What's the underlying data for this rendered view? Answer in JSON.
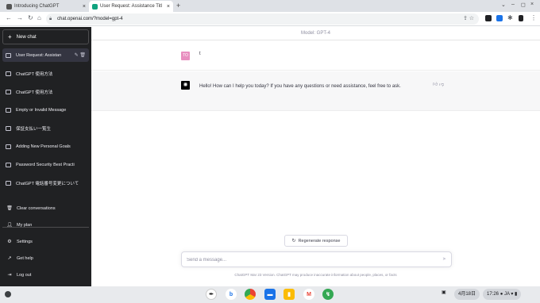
{
  "browser": {
    "tabs": [
      {
        "title": "Introducing ChatGPT",
        "active": false
      },
      {
        "title": "User Request: Assistance Titl",
        "active": true
      }
    ],
    "url": "chat.openai.com/?model=gpt-4"
  },
  "sidebar": {
    "new_chat": "New chat",
    "items": [
      {
        "label": "User Request: Assistan",
        "active": true
      },
      {
        "label": "ChatGPT 使用方法"
      },
      {
        "label": "ChatGPT 使用方法"
      },
      {
        "label": "Empty or Invalid Message"
      },
      {
        "label": "保証支払い一覧生"
      },
      {
        "label": "Adding New Personal Goals"
      },
      {
        "label": "Password Security Best Practi"
      },
      {
        "label": "ChatGPT 電話番号変更について"
      }
    ],
    "footer": [
      {
        "label": "Clear conversations",
        "icon": "trash-icon"
      },
      {
        "label": "My plan",
        "icon": "user-icon"
      },
      {
        "label": "Settings",
        "icon": "gear-icon"
      },
      {
        "label": "Get help",
        "icon": "external-link-icon"
      },
      {
        "label": "Log out",
        "icon": "logout-icon"
      }
    ]
  },
  "main": {
    "model_label": "Model: GPT-4",
    "user_avatar": "TO",
    "user_message": "t",
    "assistant_message": "Hello! How can I help you today? If you have any questions or need assistance, feel free to ask.",
    "regenerate_label": "Regenerate response",
    "input_placeholder": "Send a message...",
    "disclaimer": "ChatGPT Mar 23 Version. ChatGPT may produce inaccurate information about people, places, or facts"
  },
  "taskbar": {
    "date": "4月18日",
    "time": "17:26",
    "ime": "JA"
  },
  "colors": {
    "sidebar_bg": "#202123",
    "user_avatar_bg": "#e88fc0",
    "assistant_row_bg": "#f7f7f8"
  }
}
